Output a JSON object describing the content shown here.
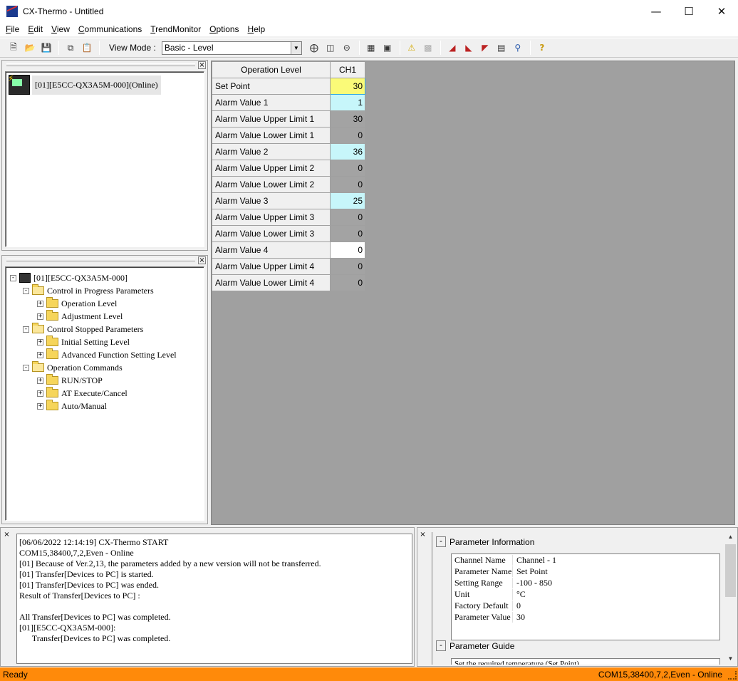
{
  "window": {
    "title": "CX-Thermo - Untitled"
  },
  "menu": [
    {
      "pre": "",
      "u": "F",
      "post": "ile"
    },
    {
      "pre": "",
      "u": "E",
      "post": "dit"
    },
    {
      "pre": "",
      "u": "V",
      "post": "iew"
    },
    {
      "pre": "",
      "u": "C",
      "post": "ommunications"
    },
    {
      "pre": "",
      "u": "T",
      "post": "rendMonitor"
    },
    {
      "pre": "",
      "u": "O",
      "post": "ptions"
    },
    {
      "pre": "",
      "u": "H",
      "post": "elp"
    }
  ],
  "toolbar": {
    "view_mode_label": "View Mode :",
    "view_mode_value": "Basic - Level"
  },
  "device_pane": {
    "device_label": "[01][E5CC-QX3A5M-000](Online)"
  },
  "tree": {
    "root": "[01][E5CC-QX3A5M-000]",
    "groups": [
      {
        "label": "Control in Progress Parameters",
        "children": [
          "Operation Level",
          "Adjustment Level"
        ]
      },
      {
        "label": "Control Stopped Parameters",
        "children": [
          "Initial Setting Level",
          "Advanced Function Setting Level"
        ]
      },
      {
        "label": "Operation Commands",
        "children": [
          "RUN/STOP",
          "AT Execute/Cancel",
          "Auto/Manual"
        ]
      }
    ]
  },
  "grid": {
    "header_name": "Operation Level",
    "header_channel": "CH1",
    "rows": [
      {
        "name": "Set Point",
        "value": "30",
        "style": "yellow"
      },
      {
        "name": "Alarm Value 1",
        "value": "1",
        "style": "cyan"
      },
      {
        "name": "Alarm Value Upper Limit 1",
        "value": "30",
        "style": "gray"
      },
      {
        "name": "Alarm Value Lower Limit 1",
        "value": "0",
        "style": "gray"
      },
      {
        "name": "Alarm Value 2",
        "value": "36",
        "style": "cyan"
      },
      {
        "name": "Alarm Value Upper Limit 2",
        "value": "0",
        "style": "gray"
      },
      {
        "name": "Alarm Value Lower Limit 2",
        "value": "0",
        "style": "gray"
      },
      {
        "name": "Alarm Value 3",
        "value": "25",
        "style": "cyan"
      },
      {
        "name": "Alarm Value Upper Limit 3",
        "value": "0",
        "style": "gray"
      },
      {
        "name": "Alarm Value Lower Limit 3",
        "value": "0",
        "style": "gray"
      },
      {
        "name": "Alarm Value 4",
        "value": "0",
        "style": "white"
      },
      {
        "name": "Alarm Value Upper Limit 4",
        "value": "0",
        "style": "gray"
      },
      {
        "name": "Alarm Value Lower Limit 4",
        "value": "0",
        "style": "gray"
      }
    ]
  },
  "log": {
    "lines": [
      "[06/06/2022 12:14:19] CX-Thermo START",
      "COM15,38400,7,2,Even - Online",
      "[01] Because of Ver.2,13, the parameters added by a new version will not be transferred.",
      "[01] Transfer[Devices to PC] is started.",
      "[01] Transfer[Devices to PC] was ended.",
      "Result of Transfer[Devices to PC] :",
      "",
      "All Transfer[Devices to PC] was completed.",
      "[01][E5CC-QX3A5M-000]:",
      "      Transfer[Devices to PC] was completed."
    ]
  },
  "param_info": {
    "section_title": "Parameter Information",
    "collapse_symbol": "-",
    "rows": [
      {
        "key": "Channel Name",
        "value": "Channel - 1"
      },
      {
        "key": "Parameter Name",
        "value": "Set Point"
      },
      {
        "key": "Setting Range",
        "value": "-100 - 850"
      },
      {
        "key": "Unit",
        "value": "°C"
      },
      {
        "key": "Factory Default",
        "value": "0"
      },
      {
        "key": "Parameter Value",
        "value": "30"
      }
    ],
    "guide_title": "Parameter Guide",
    "guide_text": "Set the required temperature (Set Point)."
  },
  "status": {
    "left": "Ready",
    "right": "COM15,38400,7,2,Even - Online"
  },
  "colors": {
    "status_bar": "#ff8a0a",
    "active_cell": "#fafa78",
    "editable_cell": "#c7f6fa",
    "disabled_cell": "#a3a3a3"
  }
}
